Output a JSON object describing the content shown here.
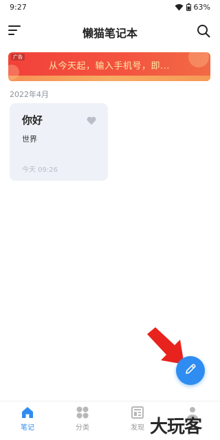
{
  "status_bar": {
    "time": "9:27",
    "battery": "63%"
  },
  "header": {
    "title": "懒猫笔记本",
    "menu_icon": "menu-icon",
    "search_icon": "search-icon"
  },
  "ad": {
    "tag": "广告",
    "text": "从今天起，输入手机号，即..."
  },
  "notes_section": {
    "month": "2022年4月",
    "notes": [
      {
        "title": "你好",
        "body": "世界",
        "time": "今天  09:26",
        "favorite": false
      }
    ]
  },
  "fab": {
    "icon": "pencil-icon"
  },
  "bottom_nav": {
    "items": [
      {
        "label": "笔记",
        "icon": "home-icon",
        "active": true
      },
      {
        "label": "分类",
        "icon": "category-icon",
        "active": false
      },
      {
        "label": "发现",
        "icon": "discover-icon",
        "active": false
      },
      {
        "label": "",
        "icon": "profile-icon",
        "active": false
      }
    ]
  },
  "watermark": "大玩客",
  "colors": {
    "accent": "#2f8cf0",
    "card_bg": "#eef2f8",
    "ad_red": "#f2413a",
    "arrow_red": "#e8231d"
  }
}
